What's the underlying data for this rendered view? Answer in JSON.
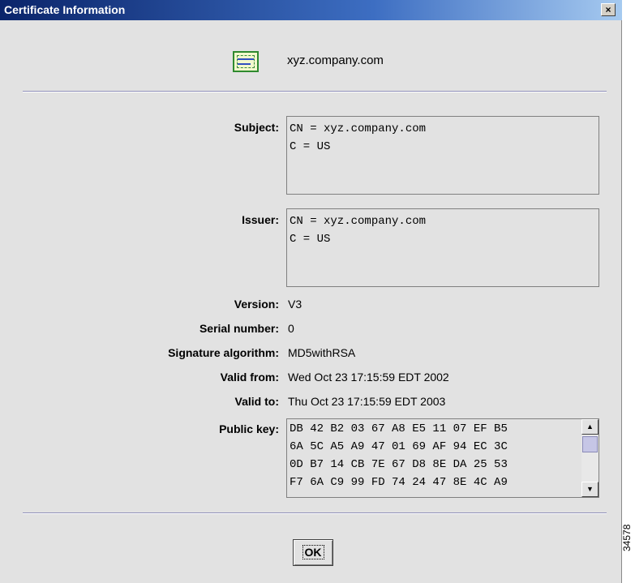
{
  "window": {
    "title": "Certificate Information",
    "close_glyph": "×"
  },
  "header": {
    "icon": "certificate-icon",
    "name": "xyz.company.com"
  },
  "subject": {
    "label": "Subject:",
    "lines": [
      "CN = xyz.company.com",
      "C = US"
    ]
  },
  "issuer": {
    "label": "Issuer:",
    "lines": [
      "CN = xyz.company.com",
      "C = US"
    ]
  },
  "fields": {
    "version": {
      "label": "Version:",
      "value": "V3"
    },
    "serial": {
      "label": "Serial number:",
      "value": "0"
    },
    "sigalg": {
      "label": "Signature algorithm:",
      "value": "MD5withRSA"
    },
    "valid_from": {
      "label": "Valid from:",
      "value": "Wed Oct 23 17:15:59 EDT 2002"
    },
    "valid_to": {
      "label": "Valid to:",
      "value": "Thu Oct 23 17:15:59 EDT 2003"
    }
  },
  "public_key": {
    "label": "Public key:",
    "lines": [
      "DB 42 B2 03 67 A8 E5 11 07 EF B5",
      "6A 5C A5 A9 47 01 69 AF 94 EC 3C",
      "0D B7 14 CB 7E 67 D8 8E DA 25 53",
      "F7 6A C9 99 FD 74 24 47 8E 4C A9"
    ]
  },
  "buttons": {
    "ok": "OK"
  },
  "figure_id": "34578",
  "colors": {
    "title_bar_start": "#0a246a",
    "title_bar_end": "#a6caf0",
    "dialog_bg": "#e2e2e2"
  }
}
